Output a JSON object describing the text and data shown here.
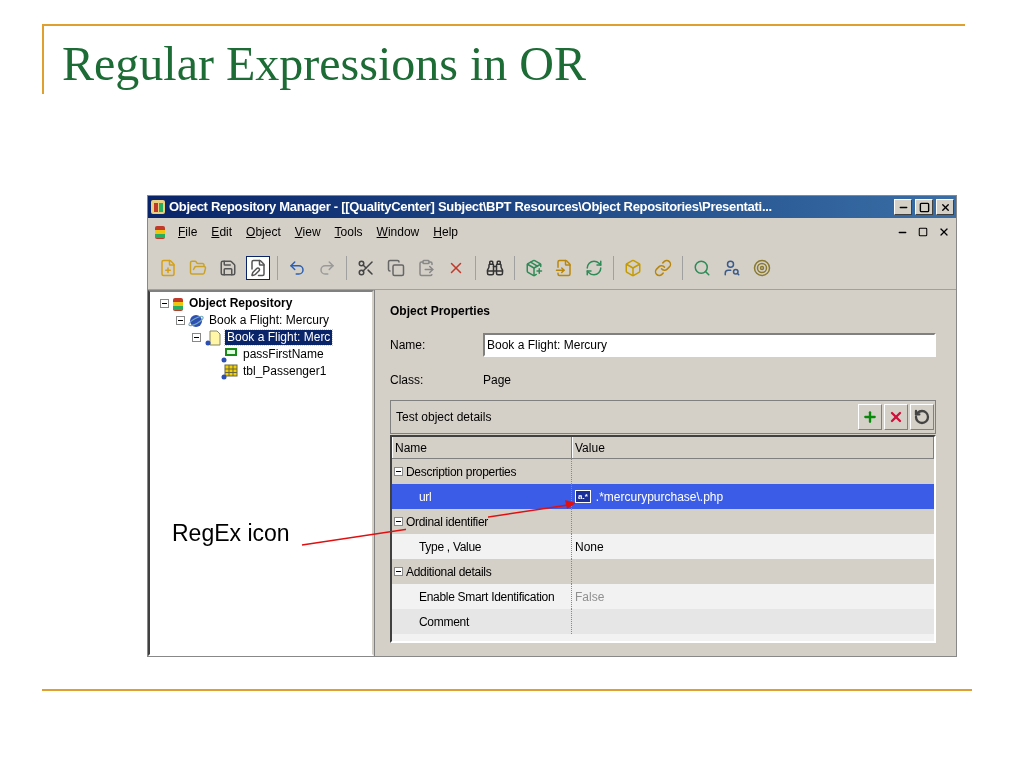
{
  "slide": {
    "title": "Regular Expressions in OR",
    "annotation": "RegEx icon"
  },
  "window": {
    "title": "Object Repository Manager - [[QualityCenter] Subject\\BPT Resources\\Object Repositories\\Presentati..."
  },
  "menu": [
    "File",
    "Edit",
    "Object",
    "View",
    "Tools",
    "Window",
    "Help"
  ],
  "toolbar": [
    [
      {
        "kind": "new",
        "pressed": false
      },
      {
        "kind": "open",
        "pressed": false
      },
      {
        "kind": "save",
        "pressed": false
      },
      {
        "kind": "edit",
        "pressed": true
      }
    ],
    [
      {
        "kind": "undo",
        "pressed": false
      },
      {
        "kind": "redo",
        "pressed": false
      }
    ],
    [
      {
        "kind": "cut",
        "pressed": false
      },
      {
        "kind": "copy",
        "pressed": false
      },
      {
        "kind": "paste",
        "pressed": false
      },
      {
        "kind": "delete",
        "pressed": false
      }
    ],
    [
      {
        "kind": "find",
        "pressed": false
      }
    ],
    [
      {
        "kind": "add",
        "pressed": false
      },
      {
        "kind": "import",
        "pressed": false
      },
      {
        "kind": "update",
        "pressed": false
      }
    ],
    [
      {
        "kind": "cube",
        "pressed": false
      },
      {
        "kind": "link",
        "pressed": false
      }
    ],
    [
      {
        "kind": "highlight",
        "pressed": false
      },
      {
        "kind": "spy",
        "pressed": false
      },
      {
        "kind": "object",
        "pressed": false
      }
    ]
  ],
  "tree": [
    {
      "label": "Object Repository",
      "kind": "root",
      "selected": false,
      "children": [
        {
          "label": "Book a Flight: Mercury",
          "kind": "browser",
          "selected": false,
          "children": [
            {
              "label": "Book a Flight: Merc",
              "kind": "page",
              "selected": true,
              "children": [
                {
                  "label": "passFirstName",
                  "kind": "edit",
                  "selected": false
                },
                {
                  "label": "tbl_Passenger1",
                  "kind": "table",
                  "selected": false
                }
              ]
            }
          ]
        }
      ]
    }
  ],
  "properties": {
    "heading": "Object Properties",
    "name_label": "Name:",
    "name_value": "Book a Flight: Mercury",
    "class_label": "Class:",
    "class_value": "Page"
  },
  "details": {
    "title": "Test object details",
    "regex_badge": "a.*",
    "columns": [
      "Name",
      "Value"
    ],
    "rows": [
      {
        "kind": "group",
        "label": "Description properties",
        "selected": false
      },
      {
        "kind": "prop",
        "label": "url",
        "value": ".*mercurypurchase\\.php",
        "regex": true,
        "disabled": false,
        "selected": true
      },
      {
        "kind": "group",
        "label": "Ordinal identifier",
        "selected": false
      },
      {
        "kind": "prop",
        "label": "Type , Value",
        "value": "None",
        "regex": false,
        "disabled": false,
        "selected": false
      },
      {
        "kind": "group",
        "label": "Additional details",
        "selected": false
      },
      {
        "kind": "prop",
        "label": "Enable Smart Identification",
        "value": "False",
        "regex": false,
        "disabled": true,
        "selected": false
      },
      {
        "kind": "prop",
        "label": "Comment",
        "regex": false,
        "selected": false
      }
    ]
  }
}
